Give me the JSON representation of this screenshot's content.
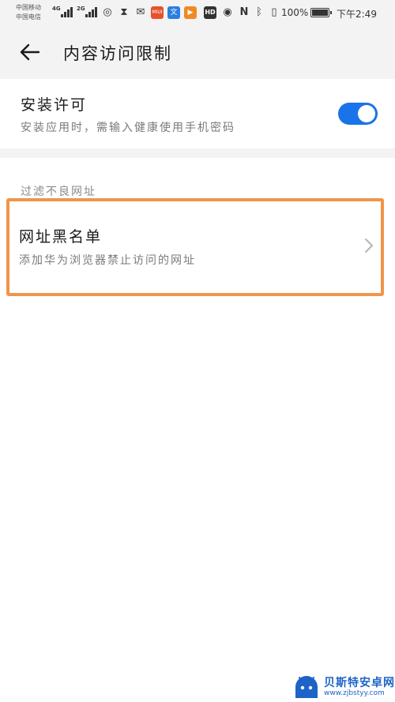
{
  "status_bar": {
    "carrier_1": "中国移动",
    "carrier_2": "中国电信",
    "net_1": "4G",
    "net_2": "2G",
    "app_badge_1": "MIUI",
    "app_badge_2": "文",
    "hd_badge": "HD",
    "battery_text": "100%",
    "time": "下午2:49"
  },
  "header": {
    "title": "内容访问限制"
  },
  "install_permission": {
    "title": "安装许可",
    "subtitle": "安装应用时，需输入健康使用手机密码",
    "enabled": true
  },
  "filter_section": {
    "header": "过滤不良网址",
    "blacklist_title": "网址黑名单",
    "blacklist_subtitle": "添加华为浏览器禁止访问的网址"
  },
  "watermark": {
    "title": "贝斯特安卓网",
    "url": "www.zjbstyy.com"
  },
  "colors": {
    "accent": "#1a73e8",
    "highlight": "#f0954a",
    "watermark": "#1d63c8"
  }
}
